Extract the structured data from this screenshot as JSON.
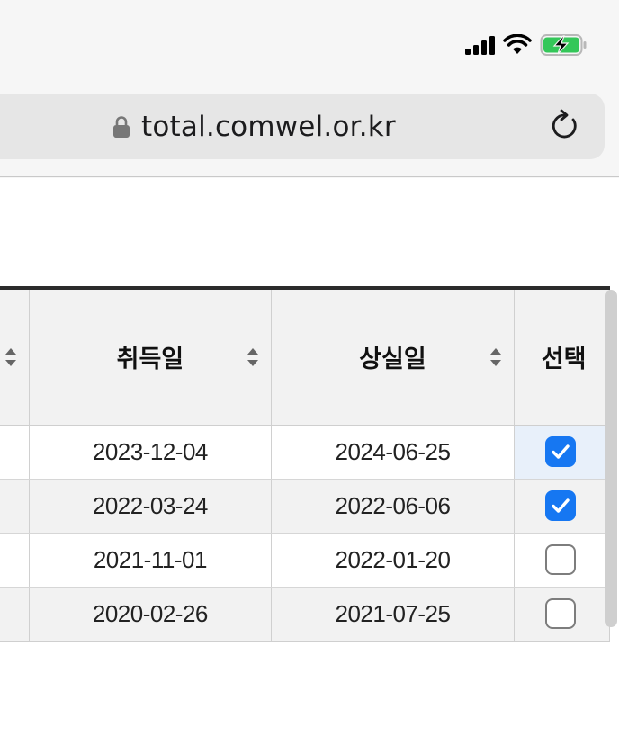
{
  "browser": {
    "url": "total.comwel.or.kr"
  },
  "table": {
    "headers": [
      "취득일",
      "상실일",
      "선택"
    ],
    "rows": [
      {
        "acquired": "2023-12-04",
        "lost": "2024-06-25",
        "selected": true
      },
      {
        "acquired": "2022-03-24",
        "lost": "2022-06-06",
        "selected": true
      },
      {
        "acquired": "2021-11-01",
        "lost": "2022-01-20",
        "selected": false
      },
      {
        "acquired": "2020-02-26",
        "lost": "2021-07-25",
        "selected": false
      }
    ]
  },
  "colors": {
    "accent": "#1677f2",
    "battery_green": "#34c759"
  }
}
